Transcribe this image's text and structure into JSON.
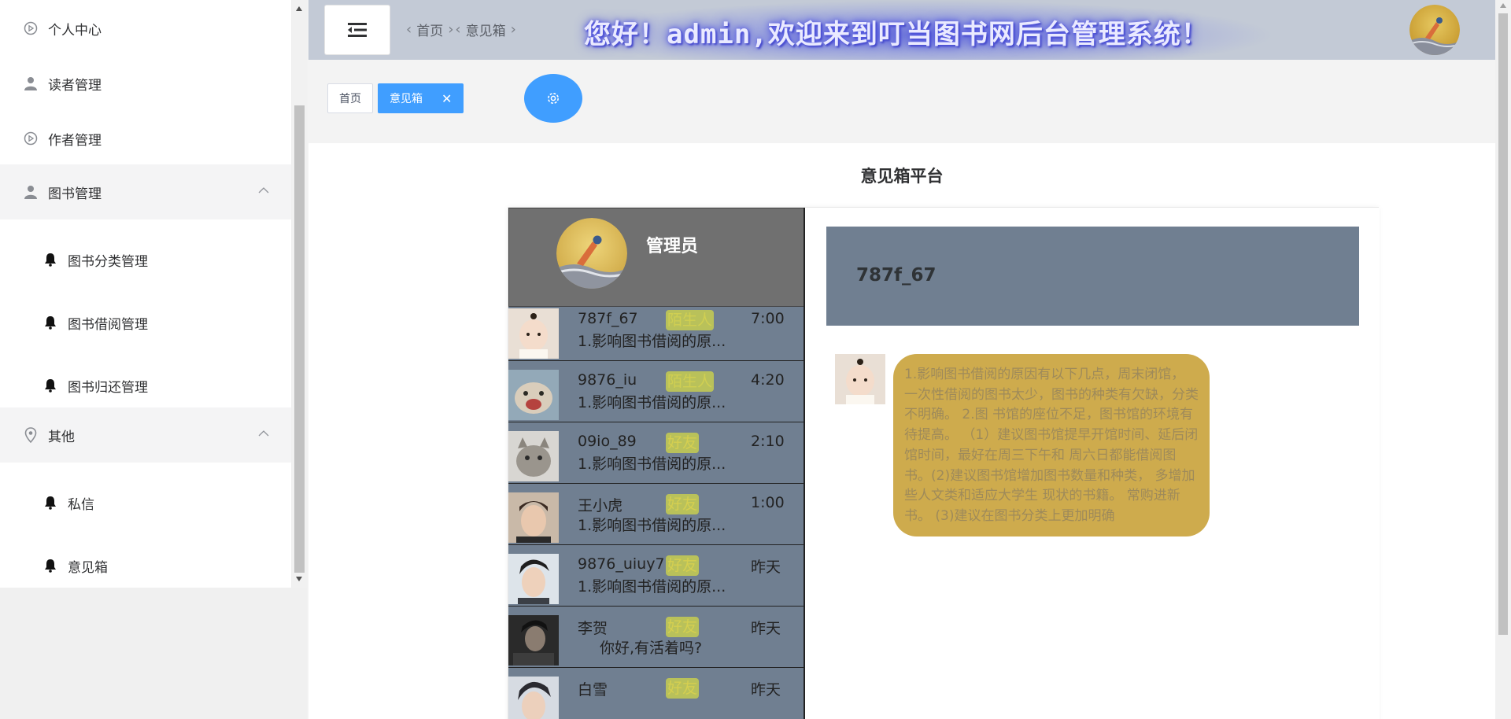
{
  "sidebar": {
    "items": [
      {
        "label": "个人中心",
        "icon": "play-circle-icon"
      },
      {
        "label": "读者管理",
        "icon": "user-icon"
      },
      {
        "label": "作者管理",
        "icon": "play-circle-icon"
      },
      {
        "label": "图书管理",
        "icon": "user-icon",
        "expanded": true,
        "children": [
          {
            "label": "图书分类管理",
            "icon": "bell-icon"
          },
          {
            "label": "图书借阅管理",
            "icon": "bell-icon"
          },
          {
            "label": "图书归还管理",
            "icon": "bell-icon"
          }
        ]
      },
      {
        "label": "其他",
        "icon": "location-icon",
        "expanded": true,
        "children": [
          {
            "label": "私信",
            "icon": "bell-icon"
          },
          {
            "label": "意见箱",
            "icon": "bell-icon"
          }
        ]
      }
    ]
  },
  "header": {
    "breadcrumb": [
      "首页",
      "意见箱"
    ],
    "welcome": "您好！admin,欢迎来到叮当图书网后台管理系统！"
  },
  "tabs": [
    {
      "label": "首页",
      "active": false
    },
    {
      "label": "意见箱",
      "active": true,
      "closable": true
    }
  ],
  "page": {
    "title": "意见箱平台"
  },
  "chat": {
    "admin_name": "管理员",
    "contacts": [
      {
        "name": "787f_67",
        "badge": "陌生人",
        "time": "7:00",
        "preview": "1.影响图书借阅的原..."
      },
      {
        "name": "9876_iu",
        "badge": "陌生人",
        "time": "4:20",
        "preview": "1.影响图书借阅的原..."
      },
      {
        "name": "09io_89",
        "badge": "好友",
        "time": "2:10",
        "preview": "1.影响图书借阅的原..."
      },
      {
        "name": "王小虎",
        "badge": "好友",
        "time": "1:00",
        "preview": "1.影响图书借阅的原..."
      },
      {
        "name": "9876_uiuy7",
        "badge": "好友",
        "time": "昨天",
        "preview": "1.影响图书借阅的原..."
      },
      {
        "name": "李贺",
        "badge": "好友",
        "time": "昨天",
        "preview": "你好,有活着吗?"
      },
      {
        "name": "白雪",
        "badge": "好友",
        "time": "昨天",
        "preview": ""
      }
    ],
    "active_contact": "787f_67",
    "message": "1.影响图书借阅的原因有以下几点，周末闭馆， 一次性借阅的图书太少，图书的种类有欠缺，分类不明确。 2.图 书馆的座位不足，图书馆的环境有待提高。 （1）建议图书馆提早开馆时间、延后闭馆时间，最好在周三下午和 周六日都能借阅图书。(2)建议图书馆增加图书数量和种类， 多增加些人文类和适应大学生 现状的书籍。 常购进新书。 (3)建议在图书分类上更加明确"
  },
  "colors": {
    "accent": "#409eff",
    "header_bg": "#c3cad6",
    "contact_bg": "#707f91",
    "bubble_bg": "#ceab4d",
    "badge_bg": "#b9c15a"
  }
}
